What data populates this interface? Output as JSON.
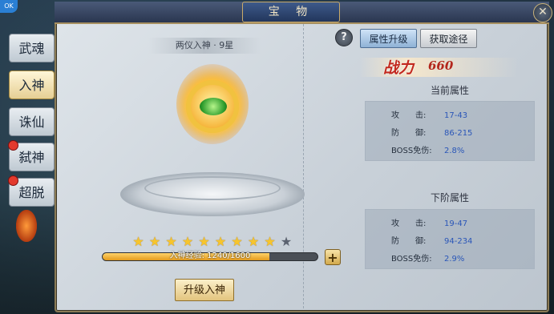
{
  "window": {
    "title": "宝 物",
    "close_icon": "close-icon"
  },
  "corner_badge": "OK",
  "side_tabs": [
    {
      "label": "武魂",
      "active": false,
      "alert": false
    },
    {
      "label": "入神",
      "active": true,
      "alert": false
    },
    {
      "label": "诛仙",
      "active": false,
      "alert": false
    },
    {
      "label": "弑神",
      "active": false,
      "alert": true
    },
    {
      "label": "超脱",
      "active": false,
      "alert": true
    }
  ],
  "item": {
    "name": "两仪入神 · 9星",
    "stars_total": 10,
    "stars_lit": 9,
    "exp_label": "入神经验: 1240/1600",
    "exp_progress": 0.775,
    "plus_label": "+",
    "upgrade_label": "升级入神"
  },
  "right": {
    "help_label": "?",
    "tabs": [
      {
        "label": "属性升级",
        "active": true
      },
      {
        "label": "获取途径",
        "active": false
      }
    ],
    "power_label": "战力",
    "power_value": "660",
    "current": {
      "title": "当前属性",
      "rows": [
        {
          "name": "攻　　击:",
          "value": "17-43"
        },
        {
          "name": "防　　御:",
          "value": "86-215"
        },
        {
          "name": "BOSS免伤:",
          "value": "2.8%"
        }
      ]
    },
    "next": {
      "title": "下阶属性",
      "rows": [
        {
          "name": "攻　　击:",
          "value": "19-47"
        },
        {
          "name": "防　　御:",
          "value": "94-234"
        },
        {
          "name": "BOSS免伤:",
          "value": "2.9%"
        }
      ]
    }
  },
  "colors": {
    "accent_gold": "#f7c52c",
    "stat_value_blue": "#2a56b8",
    "power_red": "#c2281e"
  }
}
